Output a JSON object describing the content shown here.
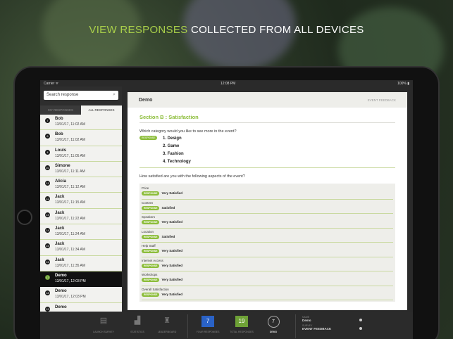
{
  "headline": {
    "accent": "VIEW RESPONSES",
    "rest": " COLLECTED FROM ALL DEVICES"
  },
  "colors": {
    "accent": "#8cbd3a",
    "tab_blue": "#2a62c6",
    "tab_green": "#6ea136"
  },
  "status": {
    "carrier": "Carrier ᯤ",
    "time": "12:08 PM",
    "battery": "100% ▮"
  },
  "sidebar": {
    "search_placeholder": "Search response",
    "search_icon": "search-icon",
    "tabs": [
      "MY RESPONSES",
      "ALL RESPONSES"
    ],
    "responses": [
      {
        "num": "7",
        "name": "Bob",
        "date": "13/01/17, 11:02 AM"
      },
      {
        "num": "6",
        "name": "Bob",
        "date": "13/01/17, 11:02 AM"
      },
      {
        "num": "4",
        "name": "Louis",
        "date": "13/01/17, 11:05 AM"
      },
      {
        "num": "10",
        "name": "Simone",
        "date": "13/01/17, 11:11 AM"
      },
      {
        "num": "11",
        "name": "Alicia",
        "date": "13/01/17, 11:12 AM"
      },
      {
        "num": "12",
        "name": "Jack",
        "date": "13/01/17, 11:15 AM"
      },
      {
        "num": "13",
        "name": "Jack",
        "date": "13/01/17, 11:22 AM"
      },
      {
        "num": "14",
        "name": "Jack",
        "date": "13/01/17, 11:24 AM"
      },
      {
        "num": "15",
        "name": "Jack",
        "date": "13/01/17, 11:34 AM"
      },
      {
        "num": "16",
        "name": "Jack",
        "date": "13/01/17, 11:35 AM"
      },
      {
        "num": "17",
        "name": "Demo",
        "date": "13/01/17, 12:03 PM"
      },
      {
        "num": "18",
        "name": "Demo",
        "date": "13/01/17, 12:03 PM"
      },
      {
        "num": "19",
        "name": "Demo",
        "date": ""
      }
    ]
  },
  "main": {
    "title": "Demo",
    "tag": "EVENT FEEDBACK",
    "section": "Section B : Satisfaction",
    "response_badge": "RESPONSE",
    "question1": "Which category would you like to see more in the event?",
    "choices": [
      "1. Design",
      "2. Game",
      "3. Fashion",
      "4. Technology"
    ],
    "question2": "How satisfied are you with the following aspects of the event?",
    "rows": [
      {
        "label": "Price",
        "answer": "Very Satisfied"
      },
      {
        "label": "Content",
        "answer": "Satisfied"
      },
      {
        "label": "Speakers",
        "answer": "Very Satisfied"
      },
      {
        "label": "Location",
        "answer": "Satisfied"
      },
      {
        "label": "Help Staff",
        "answer": "Very Satisfied"
      },
      {
        "label": "Internet Access",
        "answer": "Very Satisfied"
      },
      {
        "label": "Workshops",
        "answer": "Very Satisfied"
      },
      {
        "label": "Overall Satisfaction",
        "answer": "Very Satisfied"
      }
    ]
  },
  "tabbar": {
    "items": [
      "LAUNCH SURVEY",
      "STATISTICS",
      "LEADERBOARD"
    ],
    "my_count": "7",
    "my_label": "YOUR RESPONSES",
    "total_count": "19",
    "total_label": "TOTAL RESPONSES",
    "demo_count": "7",
    "demo_label": "DEMO",
    "info_name_key": "NAME",
    "info_name": "Demo",
    "info_survey_key": "SURVEY",
    "info_survey": "EVENT FEEDBACK"
  }
}
